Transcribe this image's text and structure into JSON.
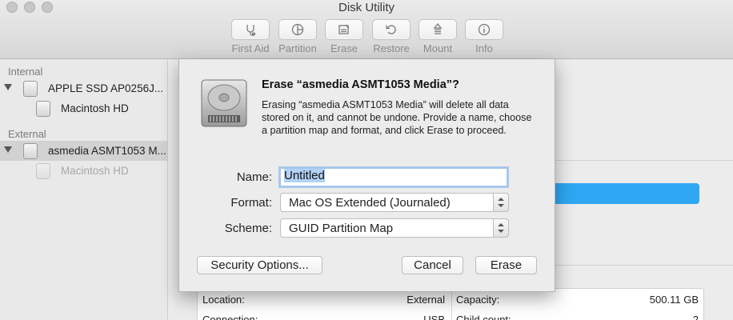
{
  "window": {
    "title": "Disk Utility"
  },
  "toolbar": [
    {
      "label": "First Aid",
      "icon": "stethoscope-icon"
    },
    {
      "label": "Partition",
      "icon": "partition-pie-icon"
    },
    {
      "label": "Erase",
      "icon": "erase-icon"
    },
    {
      "label": "Restore",
      "icon": "restore-icon"
    },
    {
      "label": "Mount",
      "icon": "mount-icon"
    },
    {
      "label": "Info",
      "icon": "info-icon"
    }
  ],
  "sidebar": {
    "internal_heading": "Internal",
    "external_heading": "External",
    "internal_disk": "APPLE SSD AP0256J...",
    "internal_volume": "Macintosh HD",
    "external_disk": "asmedia ASMT1053 M...",
    "external_volume": "Macintosh HD"
  },
  "info": {
    "location_label": "Location:",
    "location_value": "External",
    "capacity_label": "Capacity:",
    "capacity_value": "500.11 GB",
    "connection_label": "Connection:",
    "connection_value": "USB",
    "child_count_label": "Child count:",
    "child_count_value": "2"
  },
  "dialog": {
    "title": "Erase “asmedia ASMT1053 Media”?",
    "message": "Erasing “asmedia ASMT1053 Media” will delete all data stored on it, and cannot be undone. Provide a name, choose a partition map and format, and click Erase to proceed.",
    "name_label": "Name:",
    "name_value": "Untitled",
    "format_label": "Format:",
    "format_value": "Mac OS Extended (Journaled)",
    "scheme_label": "Scheme:",
    "scheme_value": "GUID Partition Map",
    "security_button": "Security Options...",
    "cancel_button": "Cancel",
    "erase_button": "Erase"
  },
  "colors": {
    "selection_blue": "#2fa7f2",
    "text_highlight": "#b3d3f6"
  }
}
